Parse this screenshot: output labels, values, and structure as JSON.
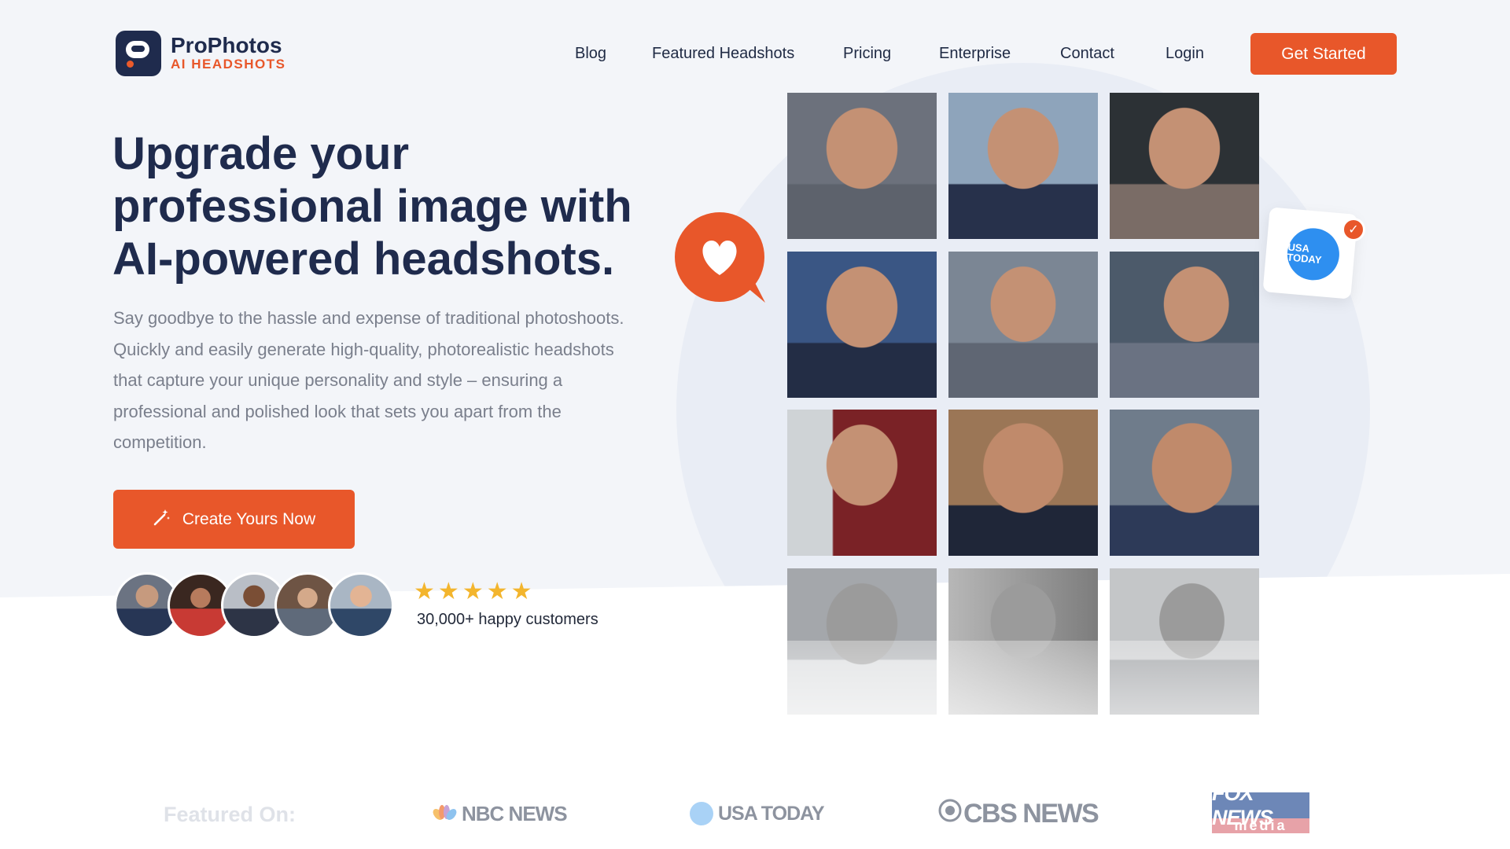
{
  "brand": {
    "name": "ProPhotos",
    "tagline": "AI HEADSHOTS"
  },
  "nav": {
    "items": [
      "Blog",
      "Featured Headshots",
      "Pricing",
      "Enterprise",
      "Contact",
      "Login"
    ],
    "cta": "Get Started"
  },
  "hero": {
    "title": "Upgrade your professional image with AI-powered headshots.",
    "description": "Say goodbye to the hassle and expense of traditional photoshoots. Quickly and easily generate high-quality, photorealistic headshots that capture your unique personality and style – ensuring a professional and polished look that sets you apart from the competition.",
    "cta": "Create Yours Now",
    "rating_stars": 5,
    "customers": "30,000+ happy customers"
  },
  "badges": {
    "usa_today": "USA TODAY"
  },
  "featured": {
    "label": "Featured On:",
    "logos": [
      "NBC NEWS",
      "USA TODAY",
      "CBS NEWS",
      "FOX NEWS",
      "media"
    ]
  },
  "colors": {
    "accent": "#e8572a",
    "navy": "#1f2b4d",
    "background": "#f3f5f9"
  }
}
